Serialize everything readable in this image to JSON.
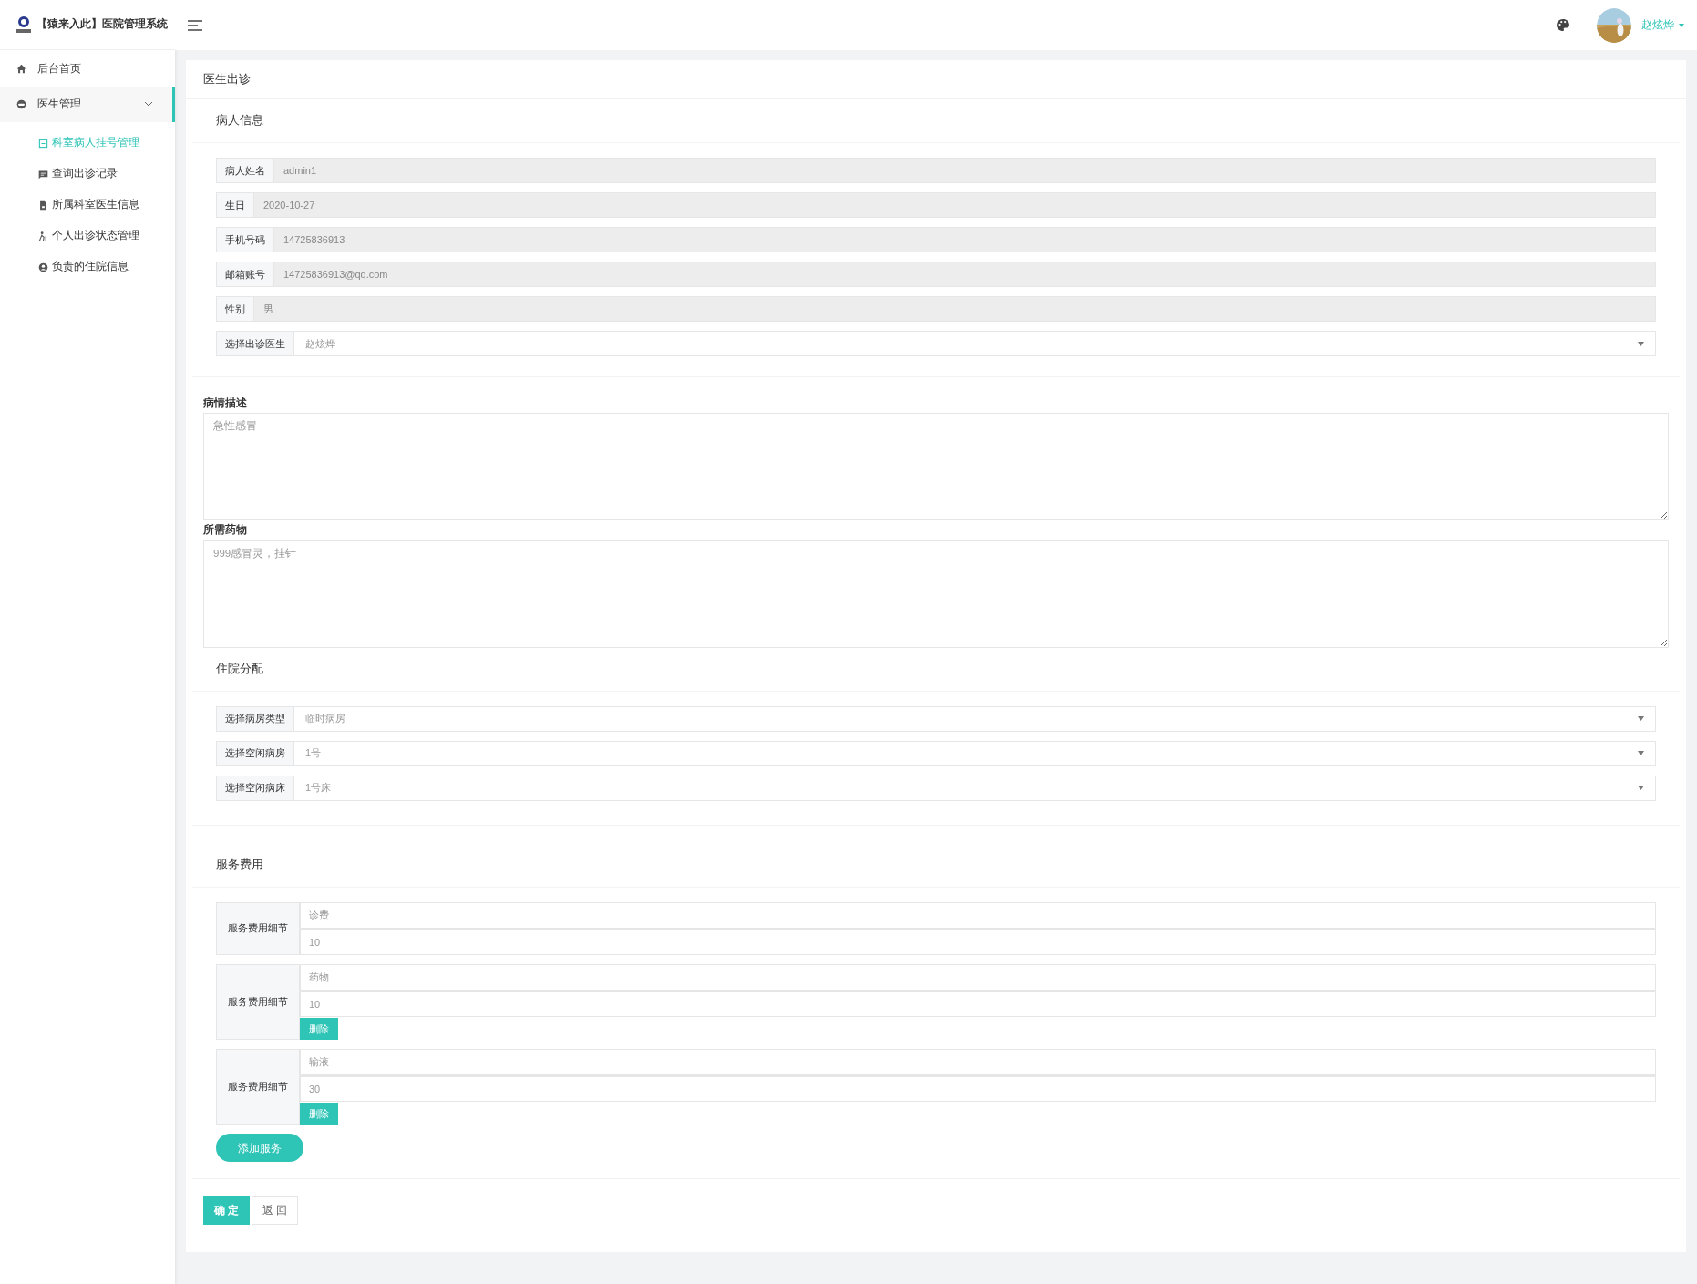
{
  "app": {
    "title": "【猿来入此】医院管理系统"
  },
  "sidebar": {
    "items": [
      {
        "label": "后台首页",
        "selected": false
      },
      {
        "label": "医生管理",
        "selected": true,
        "expanded": true,
        "children": [
          {
            "label": "科室病人挂号管理",
            "selected": true
          },
          {
            "label": "查询出诊记录",
            "selected": false
          },
          {
            "label": "所属科室医生信息",
            "selected": false
          },
          {
            "label": "个人出诊状态管理",
            "selected": false
          },
          {
            "label": "负责的住院信息",
            "selected": false
          }
        ]
      }
    ]
  },
  "header": {
    "user": "赵炫烨"
  },
  "page": {
    "title": "医生出诊",
    "patient_section": {
      "title": "病人信息",
      "fields": [
        {
          "label": "病人姓名",
          "value": "admin1",
          "kind": "readonly"
        },
        {
          "label": "生日",
          "value": "2020-10-27",
          "kind": "readonly"
        },
        {
          "label": "手机号码",
          "value": "14725836913",
          "kind": "readonly"
        },
        {
          "label": "邮箱账号",
          "value": "14725836913@qq.com",
          "kind": "readonly"
        },
        {
          "label": "性别",
          "value": "男",
          "kind": "readonly"
        },
        {
          "label": "选择出诊医生",
          "value": "赵炫烨",
          "kind": "select"
        }
      ]
    },
    "description": {
      "label": "病情描述",
      "value": "急性感冒"
    },
    "medicine": {
      "label": "所需药物",
      "value": "999感冒灵，挂针"
    },
    "hospital_section": {
      "title": "住院分配",
      "fields": [
        {
          "label": "选择病房类型",
          "value": "临时病房",
          "kind": "select"
        },
        {
          "label": "选择空闲病房",
          "value": "1号",
          "kind": "select"
        },
        {
          "label": "选择空闲病床",
          "value": "1号床",
          "kind": "select"
        }
      ]
    },
    "service_section": {
      "title": "服务费用",
      "items": [
        {
          "label": "服务费用细节",
          "name": "诊费",
          "price": "10",
          "deletable": false
        },
        {
          "label": "服务费用细节",
          "name": "药物",
          "price": "10",
          "deletable": true,
          "delete_label": "删除"
        },
        {
          "label": "服务费用细节",
          "name": "输液",
          "price": "30",
          "deletable": true,
          "delete_label": "删除"
        }
      ],
      "add_button": "添加服务"
    },
    "buttons": {
      "confirm": "确 定",
      "back": "返 回"
    }
  }
}
